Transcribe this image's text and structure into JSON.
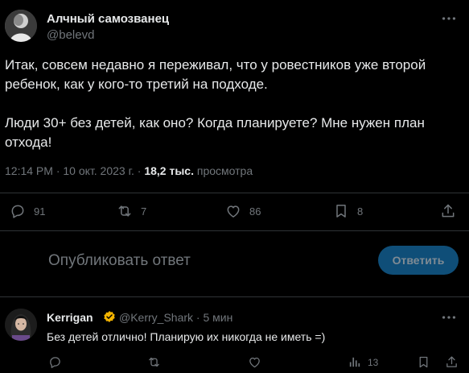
{
  "tweet": {
    "author_name": "Алчный самозванец",
    "author_handle": "@belevd",
    "text_paragraph_1": "Итак, совсем недавно я переживал, что у ровестников уже второй ребенок, как у кого-то третий на подходе.",
    "text_paragraph_2": "Люди 30+ без детей, как оно? Когда планируете? Мне нужен план отхода!",
    "time": "12:14 PM",
    "date": "10 окт. 2023 г.",
    "views_count": "18,2 тыс.",
    "views_label": "просмотра",
    "actions": {
      "replies": "91",
      "retweets": "7",
      "likes": "86",
      "bookmarks": "8"
    }
  },
  "reply_box": {
    "placeholder": "Опубликовать ответ",
    "button_label": "Ответить"
  },
  "reply_tweet": {
    "author_name": "Kerrigan",
    "author_handle": "@Kerry_Shark",
    "time_ago": "5 мин",
    "text": "Без детей отлично! Планирую их никогда не иметь =)",
    "actions": {
      "views": "13"
    }
  },
  "colors": {
    "background": "#000000",
    "text_primary": "#e7e9ea",
    "text_secondary": "#71767b",
    "divider": "#2f3336",
    "accent_button": "#0f4e78",
    "verified_badge": "#f4b400"
  },
  "icons": [
    "more-icon",
    "reply-icon",
    "retweet-icon",
    "like-icon",
    "bookmark-icon",
    "share-icon",
    "verified-badge-icon",
    "views-icon"
  ]
}
